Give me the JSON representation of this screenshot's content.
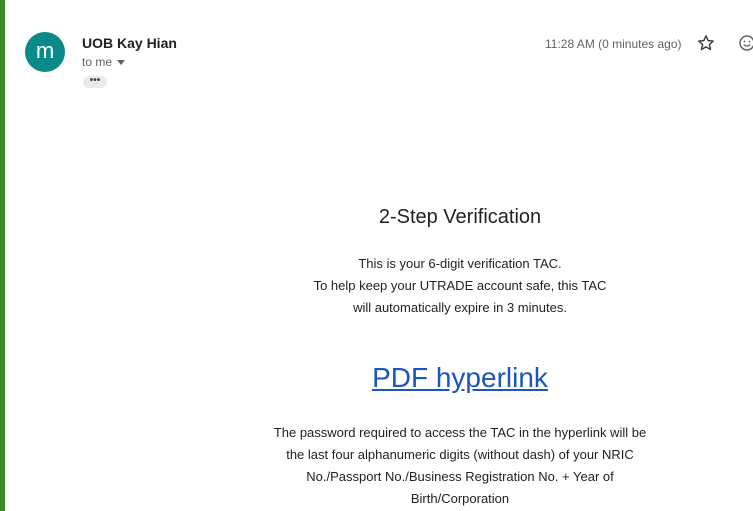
{
  "email": {
    "avatar_letter": "m",
    "sender": "UOB Kay Hian",
    "to": "to me",
    "ellipsis": "•••",
    "timestamp": "11:28 AM (0 minutes ago)"
  },
  "body": {
    "heading": "2-Step Verification",
    "line1": "This is your 6-digit verification TAC.",
    "line2": "To help keep your UTRADE account safe, this TAC",
    "line3": "will automatically expire in 3 minutes.",
    "link": "PDF hyperlink",
    "para1": "The password required to access the TAC in the hyperlink will be",
    "para2": "the last four alphanumeric digits (without dash) of your NRIC",
    "para3": "No./Passport No./Business Registration No. + Year of",
    "para4": "Birth/Corporation"
  },
  "icons": {
    "star": "star-outline-icon",
    "emoji": "smiley-icon"
  },
  "colors": {
    "accent_bar": "#3b8b2a",
    "avatar_bg": "#0b8a8a",
    "link": "#1a55c0"
  }
}
